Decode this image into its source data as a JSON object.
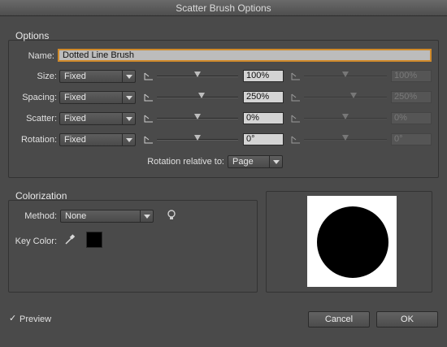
{
  "window": {
    "title": "Scatter Brush Options"
  },
  "options": {
    "title": "Options",
    "name_label": "Name:",
    "name_value": "Dotted Line Brush",
    "rows": [
      {
        "label": "Size:",
        "method": "Fixed",
        "value": "100%",
        "value2": "100%",
        "pos": 0.5,
        "pos2": 0.5
      },
      {
        "label": "Spacing:",
        "method": "Fixed",
        "value": "250%",
        "value2": "250%",
        "pos": 0.55,
        "pos2": 0.6
      },
      {
        "label": "Scatter:",
        "method": "Fixed",
        "value": "0%",
        "value2": "0%",
        "pos": 0.5,
        "pos2": 0.5
      },
      {
        "label": "Rotation:",
        "method": "Fixed",
        "value": "0°",
        "value2": "0°",
        "pos": 0.5,
        "pos2": 0.5
      }
    ],
    "rotation_relative_label": "Rotation relative to:",
    "rotation_relative_value": "Page"
  },
  "colorization": {
    "title": "Colorization",
    "method_label": "Method:",
    "method_value": "None",
    "key_color_label": "Key Color:",
    "key_color": "#000000"
  },
  "footer": {
    "preview_label": "Preview",
    "preview_checked": true,
    "cancel_label": "Cancel",
    "ok_label": "OK"
  }
}
